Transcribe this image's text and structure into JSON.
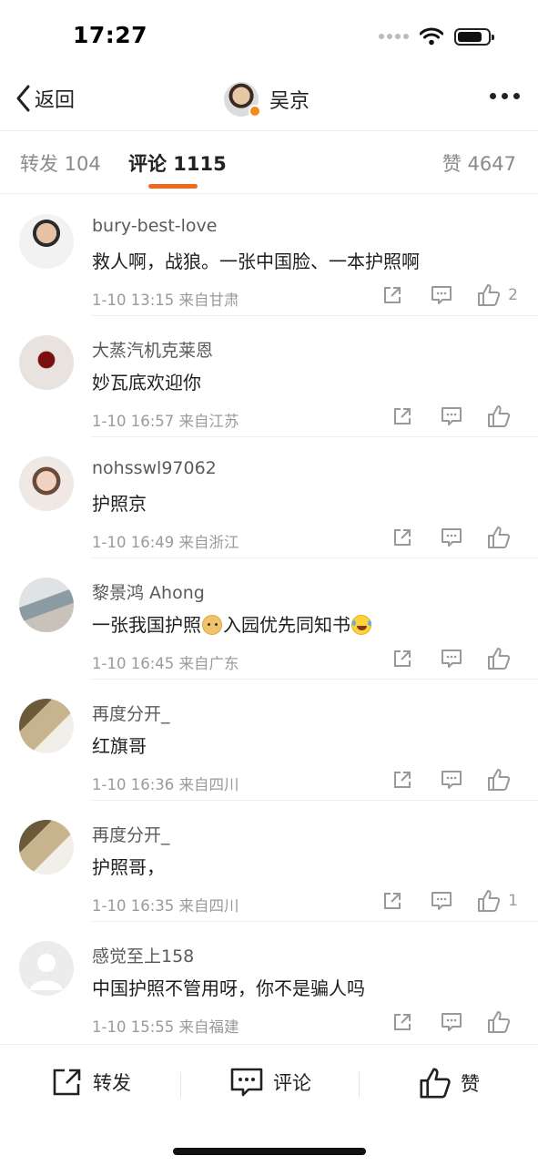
{
  "status_bar": {
    "time": "17:27",
    "battery_level": 0.8
  },
  "nav": {
    "back_label": "返回",
    "title": "吴京"
  },
  "tabs": [
    {
      "label": "转发 104",
      "active": false
    },
    {
      "label": "评论 1115",
      "active": true
    },
    {
      "label": "赞 4647",
      "active": false
    }
  ],
  "comments": [
    {
      "user": "bury-best-love",
      "text": "救人啊，战狼。一张中国脸、一本护照啊",
      "time": "1-10 13:15",
      "location": "来自甘肃",
      "likes": "2"
    },
    {
      "user": "大蒸汽机克莱恩",
      "text": "妙瓦底欢迎你",
      "time": "1-10 16:57",
      "location": "来自江苏",
      "likes": ""
    },
    {
      "user": "nohsswl97062",
      "text": "护照京",
      "time": "1-10 16:49",
      "location": "来自浙江",
      "likes": ""
    },
    {
      "user": "黎景鸿 Ahong",
      "text_parts": [
        "一张我国护照",
        "入园优先同知书"
      ],
      "time": "1-10 16:45",
      "location": "来自广东",
      "likes": ""
    },
    {
      "user": "再度分开_",
      "text": "红旗哥",
      "time": "1-10 16:36",
      "location": "来自四川",
      "likes": ""
    },
    {
      "user": "再度分开_",
      "text": "护照哥，",
      "time": "1-10 16:35",
      "location": "来自四川",
      "likes": "1"
    },
    {
      "user": "感觉至上158",
      "text": "中国护照不管用呀，你不是骗人吗",
      "time": "1-10 15:55",
      "location": "来自福建",
      "likes": ""
    }
  ],
  "bottom_bar": {
    "repost_label": "转发",
    "comment_label": "评论",
    "like_label": "赞"
  },
  "colors": {
    "accent": "#f06b1e",
    "text_secondary": "#9a9a9a"
  }
}
